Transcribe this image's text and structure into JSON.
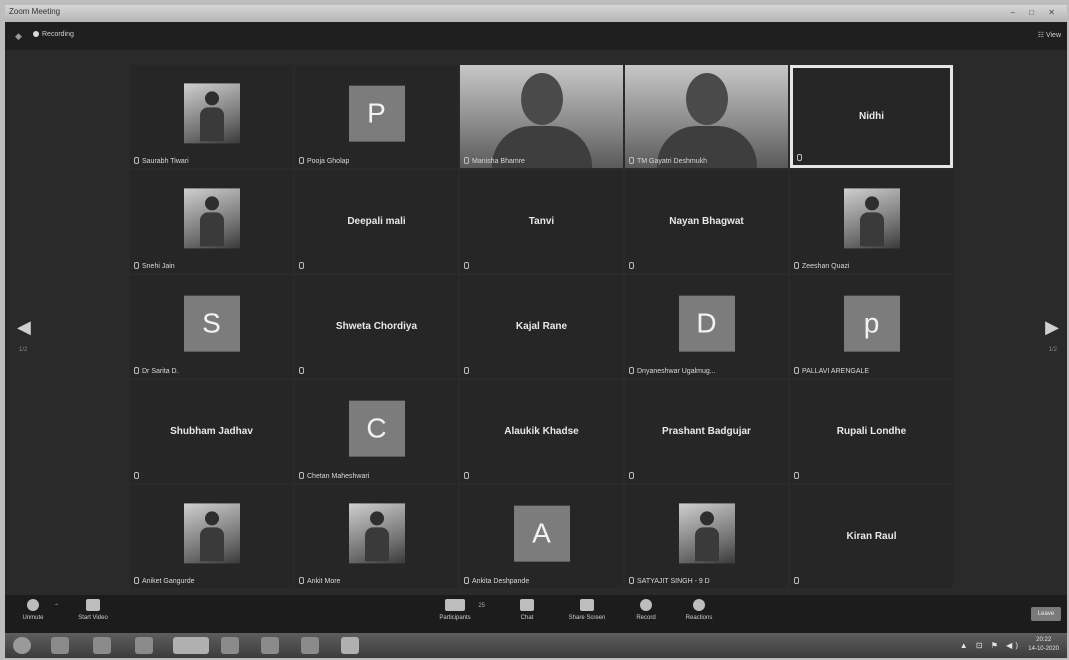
{
  "window": {
    "title": "Zoom Meeting",
    "controls": "–  □  ✕"
  },
  "topbar": {
    "recording_label": "Recording",
    "view_label": "View"
  },
  "pager": {
    "left_page": "1/2",
    "right_page": "1/2"
  },
  "tiles": [
    {
      "label": "Saurabh Tiwari",
      "center": "",
      "kind": "photo"
    },
    {
      "label": "Pooja Gholap",
      "center": "P",
      "kind": "initial"
    },
    {
      "label": "Manisha Bhamre",
      "center": "",
      "kind": "video"
    },
    {
      "label": "TM Gayatri Deshmukh",
      "center": "",
      "kind": "video"
    },
    {
      "label": "",
      "center": "Nidhi",
      "kind": "name",
      "active": true
    },
    {
      "label": "Snehi Jain",
      "center": "",
      "kind": "photo"
    },
    {
      "label": "",
      "center": "Deepali mali",
      "kind": "name"
    },
    {
      "label": "",
      "center": "Tanvi",
      "kind": "name"
    },
    {
      "label": "",
      "center": "Nayan Bhagwat",
      "kind": "name"
    },
    {
      "label": "Zeeshan Quazi",
      "center": "",
      "kind": "photo"
    },
    {
      "label": "Dr Sarita D.",
      "center": "S",
      "kind": "initial"
    },
    {
      "label": "",
      "center": "Shweta Chordiya",
      "kind": "name"
    },
    {
      "label": "",
      "center": "Kajal Rane",
      "kind": "name"
    },
    {
      "label": "Dnyaneshwar Ugalmug...",
      "center": "D",
      "kind": "initial"
    },
    {
      "label": "PALLAVI ARENGALE",
      "center": "p",
      "kind": "initial"
    },
    {
      "label": "",
      "center": "Shubham Jadhav",
      "kind": "name"
    },
    {
      "label": "Chetan Maheshwari",
      "center": "C",
      "kind": "initial"
    },
    {
      "label": "",
      "center": "Alaukik Khadse",
      "kind": "name"
    },
    {
      "label": "",
      "center": "Prashant Badgujar",
      "kind": "name"
    },
    {
      "label": "",
      "center": "Rupali Londhe",
      "kind": "name"
    },
    {
      "label": "Aniket Gangurde",
      "center": "",
      "kind": "photo"
    },
    {
      "label": "Ankit More",
      "center": "",
      "kind": "photo"
    },
    {
      "label": "Ankita Deshpande",
      "center": "A",
      "kind": "initial"
    },
    {
      "label": "SATYAJIT SINGH - 9 D",
      "center": "",
      "kind": "photo"
    },
    {
      "label": "",
      "center": "Kiran Raul",
      "kind": "name"
    }
  ],
  "controls": {
    "unmute": "Unmute",
    "start_video": "Start Video",
    "participants": "Participants",
    "participants_count": "25",
    "chat": "Chat",
    "share_screen": "Share Screen",
    "record": "Record",
    "reactions": "Reactions",
    "leave": "Leave"
  },
  "taskbar": {
    "time": "20:22",
    "date": "14-10-2020",
    "tray": "▲ ⊡ ⚑ ◀)"
  }
}
